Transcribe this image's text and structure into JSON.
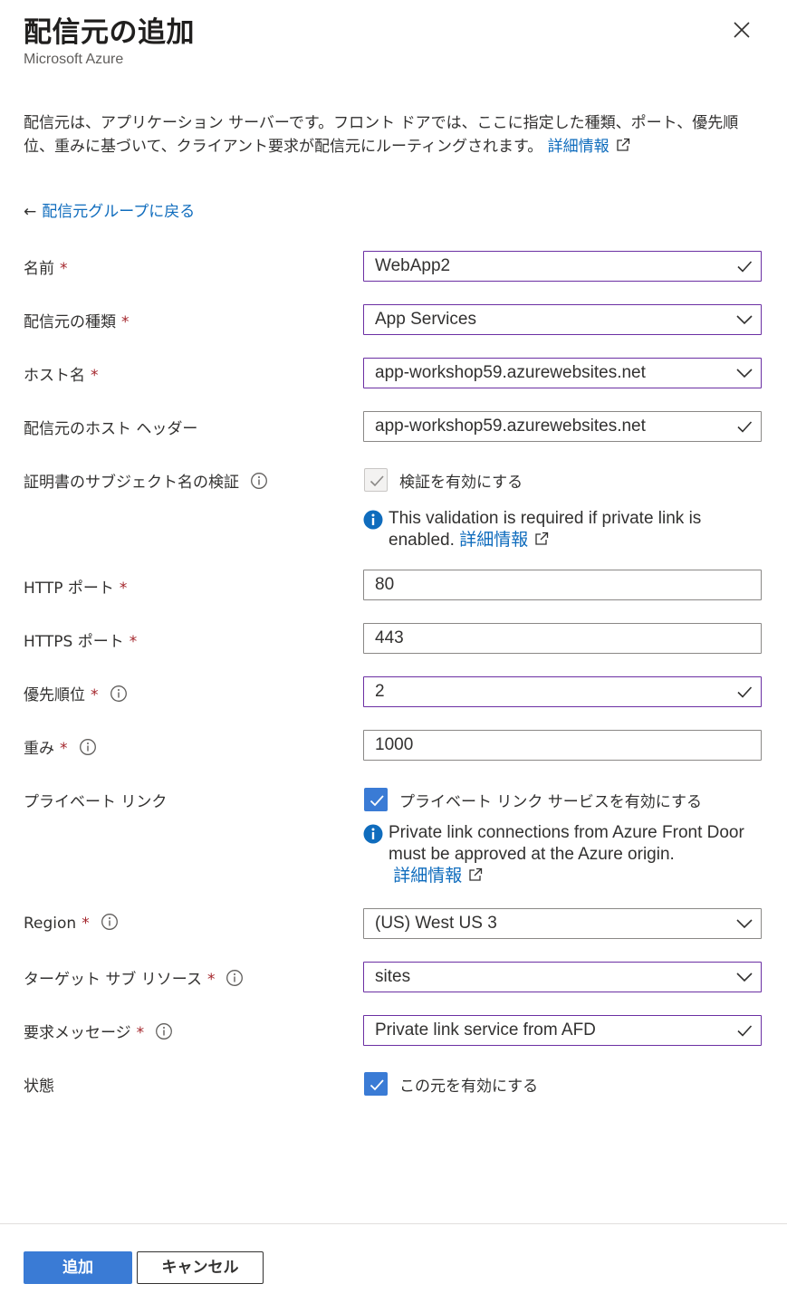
{
  "header": {
    "title": "配信元の追加",
    "subtitle": "Microsoft Azure"
  },
  "description": {
    "text": "配信元は、アプリケーション サーバーです。フロント ドアでは、ここに指定した種類、ポート、優先順位、重みに基づいて、クライアント要求が配信元にルーティングされます。",
    "link": "詳細情報"
  },
  "back_link": "配信元グループに戻る",
  "form": {
    "name": {
      "label": "名前",
      "required": "*",
      "value": "WebApp2"
    },
    "origin_type": {
      "label": "配信元の種類",
      "required": "*",
      "value": "App Services"
    },
    "host_name": {
      "label": "ホスト名",
      "required": "*",
      "value": "app-workshop59.azurewebsites.net"
    },
    "host_header": {
      "label": "配信元のホスト ヘッダー",
      "value": "app-workshop59.azurewebsites.net"
    },
    "cert_check": {
      "label": "証明書のサブジェクト名の検証",
      "checkbox_label": "検証を有効にする",
      "checked": true,
      "note": "This validation is required if private link is enabled.",
      "note_link": "詳細情報"
    },
    "http_port": {
      "label": "HTTP ポート",
      "required": "*",
      "value": "80"
    },
    "https_port": {
      "label": "HTTPS ポート",
      "required": "*",
      "value": "443"
    },
    "priority": {
      "label": "優先順位",
      "required": "*",
      "value": "2"
    },
    "weight": {
      "label": "重み",
      "required": "*",
      "value": "1000"
    },
    "private_link": {
      "label": "プライベート リンク",
      "checkbox_label": "プライベート リンク サービスを有効にする",
      "checked": true,
      "note": "Private link connections from Azure Front Door must be approved at the Azure origin.",
      "note_link": "詳細情報"
    },
    "region": {
      "label": "Region",
      "required": "*",
      "value": "(US) West US 3"
    },
    "target_subresource": {
      "label": "ターゲット サブ リソース",
      "required": "*",
      "value": "sites"
    },
    "request_message": {
      "label": "要求メッセージ",
      "required": "*",
      "value": "Private link service from AFD"
    },
    "status": {
      "label": "状態",
      "checkbox_label": "この元を有効にする",
      "checked": true
    }
  },
  "footer": {
    "add_label": "追加",
    "cancel_label": "キャンセル"
  },
  "colors": {
    "accent": "#3a7bd5",
    "link": "#0f6cbd",
    "required": "#a4262c",
    "valid_border": "#6b2fa3"
  }
}
